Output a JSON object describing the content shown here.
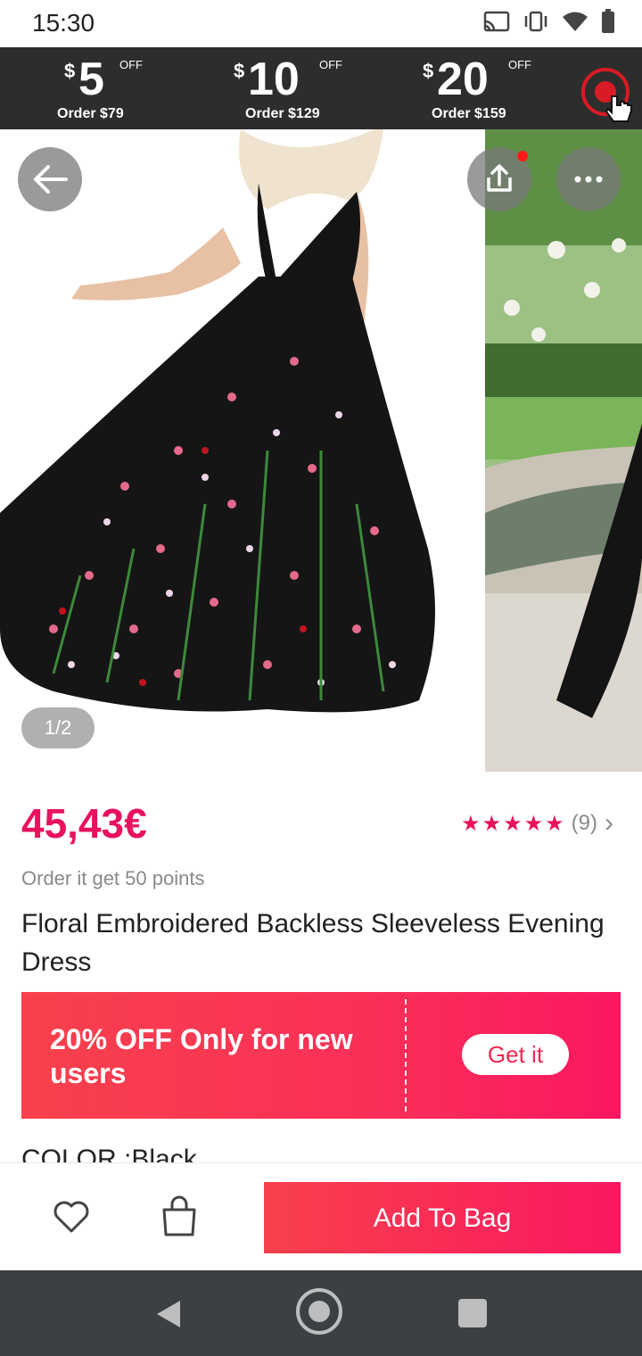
{
  "status_bar": {
    "time": "15:30",
    "icons": [
      "cast-icon",
      "vibrate-icon",
      "wifi-icon",
      "battery-icon"
    ]
  },
  "promo": {
    "coupons": [
      {
        "currency": "$",
        "amount": "5",
        "off": "OFF",
        "order": "Order $79"
      },
      {
        "currency": "$",
        "amount": "10",
        "off": "OFF",
        "order": "Order $129"
      },
      {
        "currency": "$",
        "amount": "20",
        "off": "OFF",
        "order": "Order $159"
      }
    ]
  },
  "gallery": {
    "page_indicator": "1/2"
  },
  "product": {
    "price": "45,43€",
    "stars": "★★★★★",
    "rating_count": "(9)",
    "rating_arrow": "›",
    "points": "Order it get 50 points",
    "title": "Floral Embroidered Backless Sleeveless Evening Dress",
    "color_label": "COLOR :Black"
  },
  "new_user_banner": {
    "text": "20% OFF Only for new users",
    "button": "Get it"
  },
  "action_bar": {
    "add_to_bag": "Add To Bag"
  },
  "colors": {
    "accent": "#e9125e",
    "promo_bg": "#2d2d2d",
    "nav_bg": "#3c4043"
  }
}
